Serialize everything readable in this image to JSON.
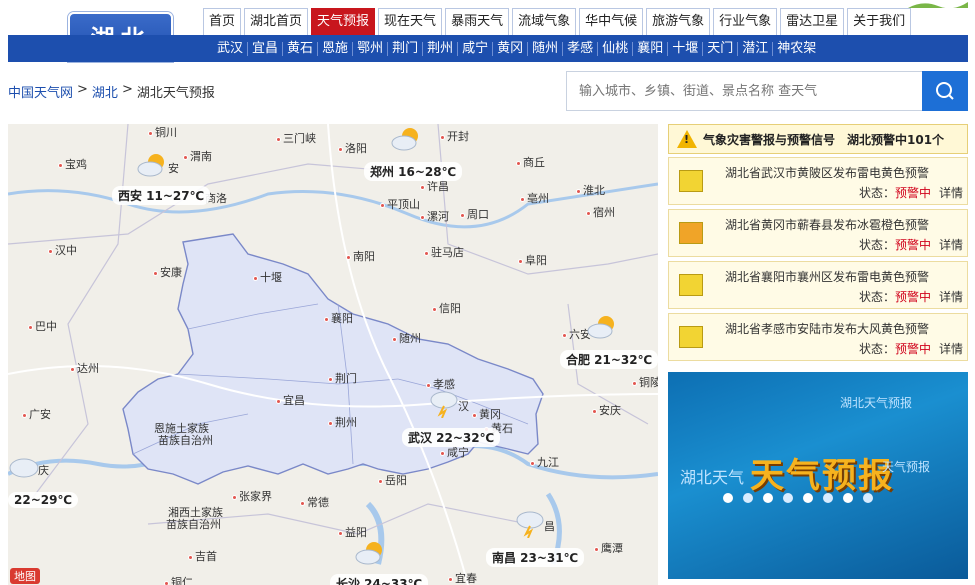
{
  "header": {
    "region_logo": "湖北",
    "topnav": [
      "首页",
      "湖北首页",
      "天气预报",
      "现在天气",
      "暴雨天气",
      "流域气象",
      "华中气候",
      "旅游气象",
      "行业气象",
      "雷达卫星",
      "关于我们"
    ],
    "active_index": 2,
    "cities": [
      "武汉",
      "宜昌",
      "黄石",
      "恩施",
      "鄂州",
      "荆门",
      "荆州",
      "咸宁",
      "黄冈",
      "随州",
      "孝感",
      "仙桃",
      "襄阳",
      "十堰",
      "天门",
      "潜江",
      "神农架"
    ]
  },
  "breadcrumb": {
    "root": "中国天气网",
    "sep": ">",
    "region": "湖北",
    "current": "湖北天气预报"
  },
  "search": {
    "placeholder": "输入城市、乡镇、街道、景点名称 查天气"
  },
  "map": {
    "weather": [
      {
        "name": "西安",
        "temp": "11~27℃",
        "label": "西安 11~27℃"
      },
      {
        "name": "郑州",
        "temp": "16~28℃",
        "label": "郑州 16~28℃"
      },
      {
        "name": "合肥",
        "temp": "21~32℃",
        "label": "合肥 21~32℃"
      },
      {
        "name": "武汉",
        "temp": "22~32℃",
        "label": "武汉 22~32℃"
      },
      {
        "name": "重庆",
        "temp": "22~29℃",
        "label": "22~29℃"
      },
      {
        "name": "南昌",
        "temp": "23~31℃",
        "label": "南昌 23~31℃"
      },
      {
        "name": "长沙",
        "temp": "24~33℃",
        "label": "长沙 24~33℃"
      }
    ],
    "places": [
      "铜川",
      "渭南",
      "三门峡",
      "洛阳",
      "开封",
      "宝鸡",
      "安",
      "商洛",
      "许昌",
      "商丘",
      "平顶山",
      "漯河",
      "周口",
      "亳州",
      "淮北",
      "宿州",
      "汉中",
      "安康",
      "十堰",
      "南阳",
      "驻马店",
      "阜阳",
      "巴中",
      "襄阳",
      "信阳",
      "达州",
      "随州",
      "六安",
      "荆门",
      "孝感",
      "宜昌",
      "黄冈",
      "广安",
      "安庆",
      "恩施土家族",
      "苗族自治州",
      "荆州",
      "黄石",
      "铜陵",
      "咸宁",
      "九江",
      "张家界",
      "常德",
      "岳阳",
      "湘西土家族",
      "苗族自治州",
      "益阳",
      "鹰潭",
      "吉首",
      "铜仁",
      "宜春",
      "汉",
      "庆",
      "昌"
    ],
    "logo": "地图"
  },
  "warnings": {
    "title": "气象灾害警报与预警信号　湖北预警中101个",
    "items": [
      {
        "text": "湖北省武汉市黄陂区发布雷电黄色预警",
        "status_label": "状态：",
        "status": "预警中",
        "detail": "详情"
      },
      {
        "text": "湖北省黄冈市蕲春县发布冰雹橙色预警",
        "status_label": "状态：",
        "status": "预警中",
        "detail": "详情"
      },
      {
        "text": "湖北省襄阳市襄州区发布雷电黄色预警",
        "status_label": "状态：",
        "status": "预警中",
        "detail": "详情"
      },
      {
        "text": "湖北省孝感市安陆市发布大风黄色预警",
        "status_label": "状态：",
        "status": "预警中",
        "detail": "详情"
      }
    ]
  },
  "banner": {
    "title": "天气预报",
    "caption_top": "湖北天气预报",
    "caption_left": "湖北天气",
    "caption_right": "天气预报"
  }
}
